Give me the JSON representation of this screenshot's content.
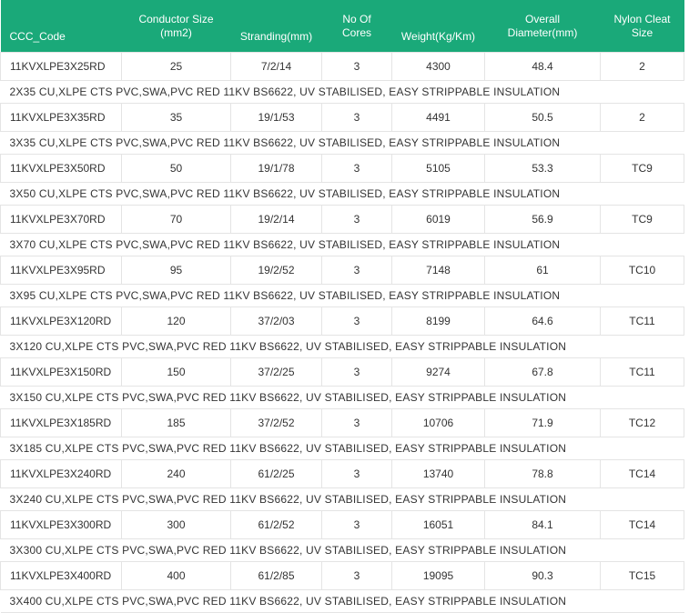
{
  "headers": {
    "code": "CCC_Code",
    "size_line1": "Conductor Size",
    "size_line2": "(mm2)",
    "stranding": "Stranding(mm)",
    "cores_line1": "No Of",
    "cores_line2": "Cores",
    "weight": "Weight(Kg/Km)",
    "diameter_line1": "Overall",
    "diameter_line2": "Diameter(mm)",
    "cleat_line1": "Nylon Cleat",
    "cleat_line2": "Size"
  },
  "rows": [
    {
      "code": "11KVXLPE3X25RD",
      "size": "25",
      "stranding": "7/2/14",
      "cores": "3",
      "weight": "4300",
      "diameter": "48.4",
      "cleat": "2",
      "desc": "2X35 CU,XLPE CTS PVC,SWA,PVC RED 11KV BS6622, UV STABILISED, EASY STRIPPABLE INSULATION"
    },
    {
      "code": "11KVXLPE3X35RD",
      "size": "35",
      "stranding": "19/1/53",
      "cores": "3",
      "weight": "4491",
      "diameter": "50.5",
      "cleat": "2",
      "desc": "3X35 CU,XLPE CTS PVC,SWA,PVC RED 11KV BS6622, UV STABILISED, EASY STRIPPABLE INSULATION"
    },
    {
      "code": "11KVXLPE3X50RD",
      "size": "50",
      "stranding": "19/1/78",
      "cores": "3",
      "weight": "5105",
      "diameter": "53.3",
      "cleat": "TC9",
      "desc": "3X50 CU,XLPE CTS PVC,SWA,PVC RED 11KV BS6622, UV STABILISED, EASY STRIPPABLE INSULATION"
    },
    {
      "code": "11KVXLPE3X70RD",
      "size": "70",
      "stranding": "19/2/14",
      "cores": "3",
      "weight": "6019",
      "diameter": "56.9",
      "cleat": "TC9",
      "desc": "3X70 CU,XLPE CTS PVC,SWA,PVC RED 11KV BS6622, UV STABILISED, EASY STRIPPABLE INSULATION"
    },
    {
      "code": "11KVXLPE3X95RD",
      "size": "95",
      "stranding": "19/2/52",
      "cores": "3",
      "weight": "7148",
      "diameter": "61",
      "cleat": "TC10",
      "desc": "3X95 CU,XLPE CTS PVC,SWA,PVC RED 11KV BS6622, UV STABILISED, EASY STRIPPABLE INSULATION"
    },
    {
      "code": "11KVXLPE3X120RD",
      "size": "120",
      "stranding": "37/2/03",
      "cores": "3",
      "weight": "8199",
      "diameter": "64.6",
      "cleat": "TC11",
      "desc": "3X120 CU,XLPE CTS PVC,SWA,PVC RED 11KV BS6622, UV STABILISED, EASY STRIPPABLE INSULATION"
    },
    {
      "code": "11KVXLPE3X150RD",
      "size": "150",
      "stranding": "37/2/25",
      "cores": "3",
      "weight": "9274",
      "diameter": "67.8",
      "cleat": "TC11",
      "desc": "3X150 CU,XLPE CTS PVC,SWA,PVC RED 11KV BS6622, UV STABILISED, EASY STRIPPABLE INSULATION"
    },
    {
      "code": "11KVXLPE3X185RD",
      "size": "185",
      "stranding": "37/2/52",
      "cores": "3",
      "weight": "10706",
      "diameter": "71.9",
      "cleat": "TC12",
      "desc": "3X185 CU,XLPE CTS PVC,SWA,PVC RED 11KV BS6622, UV STABILISED, EASY STRIPPABLE INSULATION"
    },
    {
      "code": "11KVXLPE3X240RD",
      "size": "240",
      "stranding": "61/2/25",
      "cores": "3",
      "weight": "13740",
      "diameter": "78.8",
      "cleat": "TC14",
      "desc": "3X240 CU,XLPE CTS PVC,SWA,PVC RED 11KV BS6622, UV STABILISED, EASY STRIPPABLE INSULATION"
    },
    {
      "code": "11KVXLPE3X300RD",
      "size": "300",
      "stranding": "61/2/52",
      "cores": "3",
      "weight": "16051",
      "diameter": "84.1",
      "cleat": "TC14",
      "desc": "3X300 CU,XLPE CTS PVC,SWA,PVC RED 11KV BS6622, UV STABILISED, EASY STRIPPABLE INSULATION"
    },
    {
      "code": "11KVXLPE3X400RD",
      "size": "400",
      "stranding": "61/2/85",
      "cores": "3",
      "weight": "19095",
      "diameter": "90.3",
      "cleat": "TC15",
      "desc": "3X400 CU,XLPE CTS PVC,SWA,PVC RED 11KV BS6622, UV STABILISED, EASY STRIPPABLE INSULATION"
    }
  ]
}
